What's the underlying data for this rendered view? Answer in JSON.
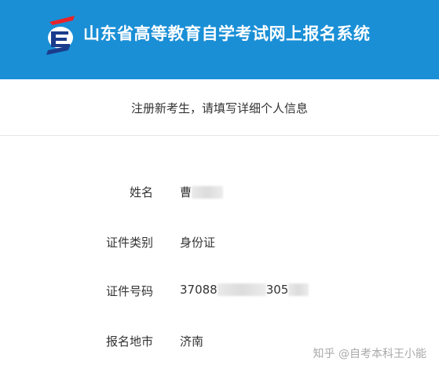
{
  "header": {
    "title": "山东省高等教育自学考试网上报名系统",
    "background": "#1a8fd6",
    "logo_icon": "exam-logo-icon"
  },
  "subheader": {
    "text": "注册新考生，请填写详细个人信息"
  },
  "form": {
    "rows": [
      {
        "label": "姓名",
        "value_prefix": "曹",
        "value_suffix": ""
      },
      {
        "label": "证件类别",
        "value": "身份证"
      },
      {
        "label": "证件号码",
        "value_prefix": "37088",
        "value_suffix": "305"
      },
      {
        "label": "报名地市",
        "value": "济南"
      }
    ]
  },
  "watermark": {
    "text": "知乎 @自考本科王小能"
  }
}
